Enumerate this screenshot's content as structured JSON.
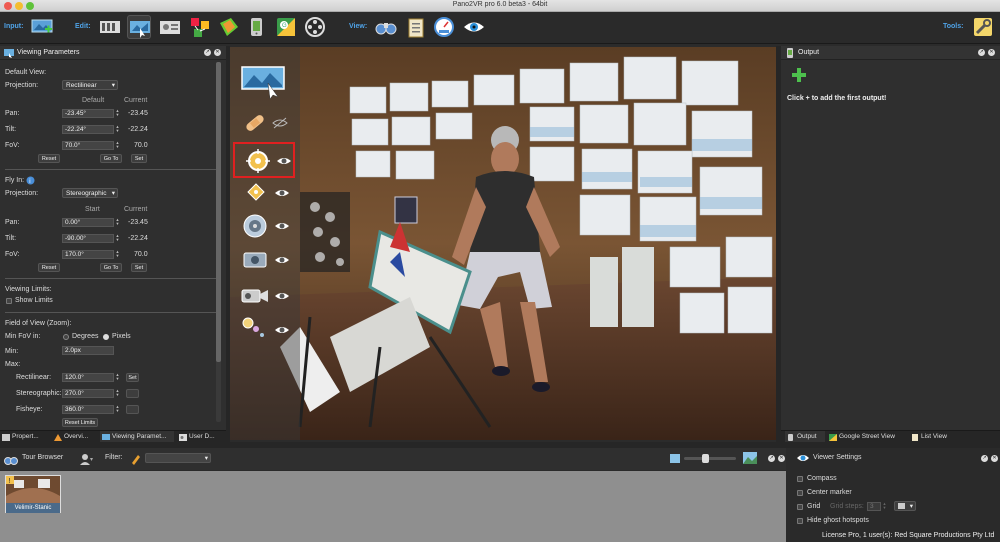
{
  "window": {
    "title": "Pano2VR pro 6.0 beta3 - 64bit"
  },
  "toolbar": {
    "input_label": "Input:",
    "edit_label": "Edit:",
    "view_label": "View:",
    "tools_label": "Tools:"
  },
  "viewing_params": {
    "title": "Viewing Parameters",
    "default_view_label": "Default View:",
    "projection_label": "Projection:",
    "projection_value": "Rectilinear",
    "col_default": "Default",
    "col_current": "Current",
    "pan_label": "Pan:",
    "pan_default": "-23.45°",
    "pan_current": "-23.45",
    "tilt_label": "Tilt:",
    "tilt_default": "-22.24°",
    "tilt_current": "-22.24",
    "fov_label": "FoV:",
    "fov_default": "70.0°",
    "fov_current": "70.0",
    "reset": "Reset",
    "goto": "Go To",
    "set": "Set",
    "flyin_label": "Fly In:",
    "flyin_projection_value": "Stereographic",
    "col_start": "Start",
    "fi_pan_start": "0.00°",
    "fi_pan_current": "-23.45",
    "fi_tilt_start": "-90.00°",
    "fi_tilt_current": "-22.24",
    "fi_fov_start": "170.0°",
    "fi_fov_current": "70.0",
    "viewing_limits_label": "Viewing Limits:",
    "show_limits": "Show Limits",
    "fov_zoom_label": "Field of View (Zoom):",
    "min_fov_in": "Min FoV in:",
    "degrees": "Degrees",
    "pixels": "Pixels",
    "min_label": "Min:",
    "min_value": "2.0px",
    "max_label": "Max:",
    "rect_label": "Rectilinear:",
    "rect_value": "120.0°",
    "stereo_label": "Stereographic:",
    "stereo_value": "270.0°",
    "fish_label": "Fisheye:",
    "fish_value": "360.0°",
    "reset_limits": "Reset Limits"
  },
  "left_tabs": [
    {
      "label": "Propert..."
    },
    {
      "label": "Overvi..."
    },
    {
      "label": "Viewing Paramet..."
    },
    {
      "label": "User D..."
    }
  ],
  "output": {
    "title": "Output",
    "hint": "Click + to add the first output!"
  },
  "right_tabs": [
    {
      "label": "Output"
    },
    {
      "label": "Google Street View"
    },
    {
      "label": "List View"
    }
  ],
  "tour_browser": {
    "title": "Tour Browser",
    "filter_label": "Filter:",
    "thumb_label": "Velimir-Stanic"
  },
  "viewer_settings": {
    "title": "Viewer Settings",
    "compass": "Compass",
    "center_marker": "Center marker",
    "grid": "Grid",
    "grid_steps": "Grid steps:",
    "grid_steps_value": "3",
    "hide_ghost": "Hide ghost hotspots"
  },
  "status": {
    "license": "License Pro, 1 user(s): Red Square Productions Pty Ltd"
  }
}
